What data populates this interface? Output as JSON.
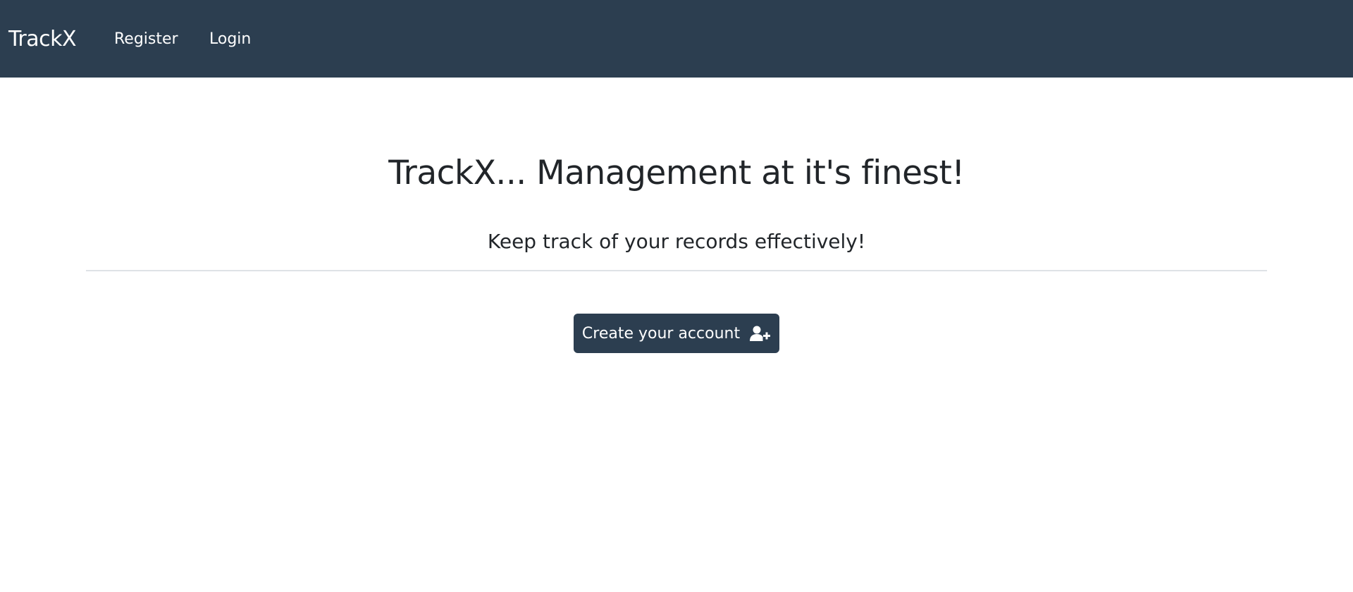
{
  "navbar": {
    "brand": "TrackX",
    "links": [
      {
        "label": "Register"
      },
      {
        "label": "Login"
      }
    ],
    "background_color": "#2c3e50"
  },
  "hero": {
    "title": "TrackX... Management at it's finest!",
    "subtitle": "Keep track of your records effectively!",
    "cta": {
      "label": "Create your account",
      "icon": "user-plus-icon"
    }
  }
}
